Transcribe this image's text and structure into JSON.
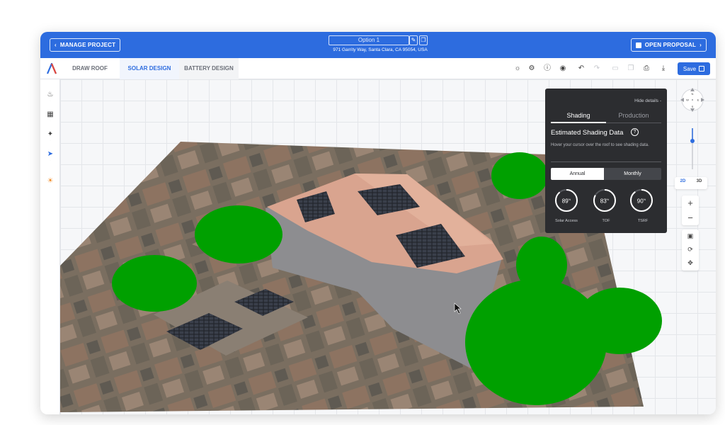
{
  "topbar": {
    "manage_project": "MANAGE PROJECT",
    "option_name": "Option 1",
    "address": "971 Garrity Way, Santa Clara, CA 95054, USA",
    "open_proposal": "OPEN PROPOSAL"
  },
  "tabs": {
    "draw_roof": "DRAW ROOF",
    "solar_design": "SOLAR DESIGN",
    "battery_design": "BATTERY DESIGN"
  },
  "toolbar": {
    "save_label": "Save"
  },
  "shading_panel": {
    "hide_details": "Hide details -",
    "tab_shading": "Shading",
    "tab_production": "Production",
    "title": "Estimated Shading Data",
    "hover_hint": "Hover your cursor over the roof to see shading data.",
    "seg_annual": "Annual",
    "seg_monthly": "Monthly",
    "gauges": [
      {
        "value": "89",
        "unit": "%",
        "label": "Solar Access",
        "fraction": 0.89
      },
      {
        "value": "83",
        "unit": "%",
        "label": "TOF",
        "fraction": 0.83
      },
      {
        "value": "90",
        "unit": "%",
        "label": "TSRF",
        "fraction": 0.9
      }
    ]
  },
  "compass": {
    "n": "N",
    "s": "S",
    "e": "E",
    "w": "W"
  },
  "view_toggle": {
    "two_d": "2D",
    "three_d": "3D"
  },
  "colors": {
    "brand_blue": "#2d6cdf",
    "tree_green": "#00a000",
    "panel_dark": "#2c2d30"
  }
}
